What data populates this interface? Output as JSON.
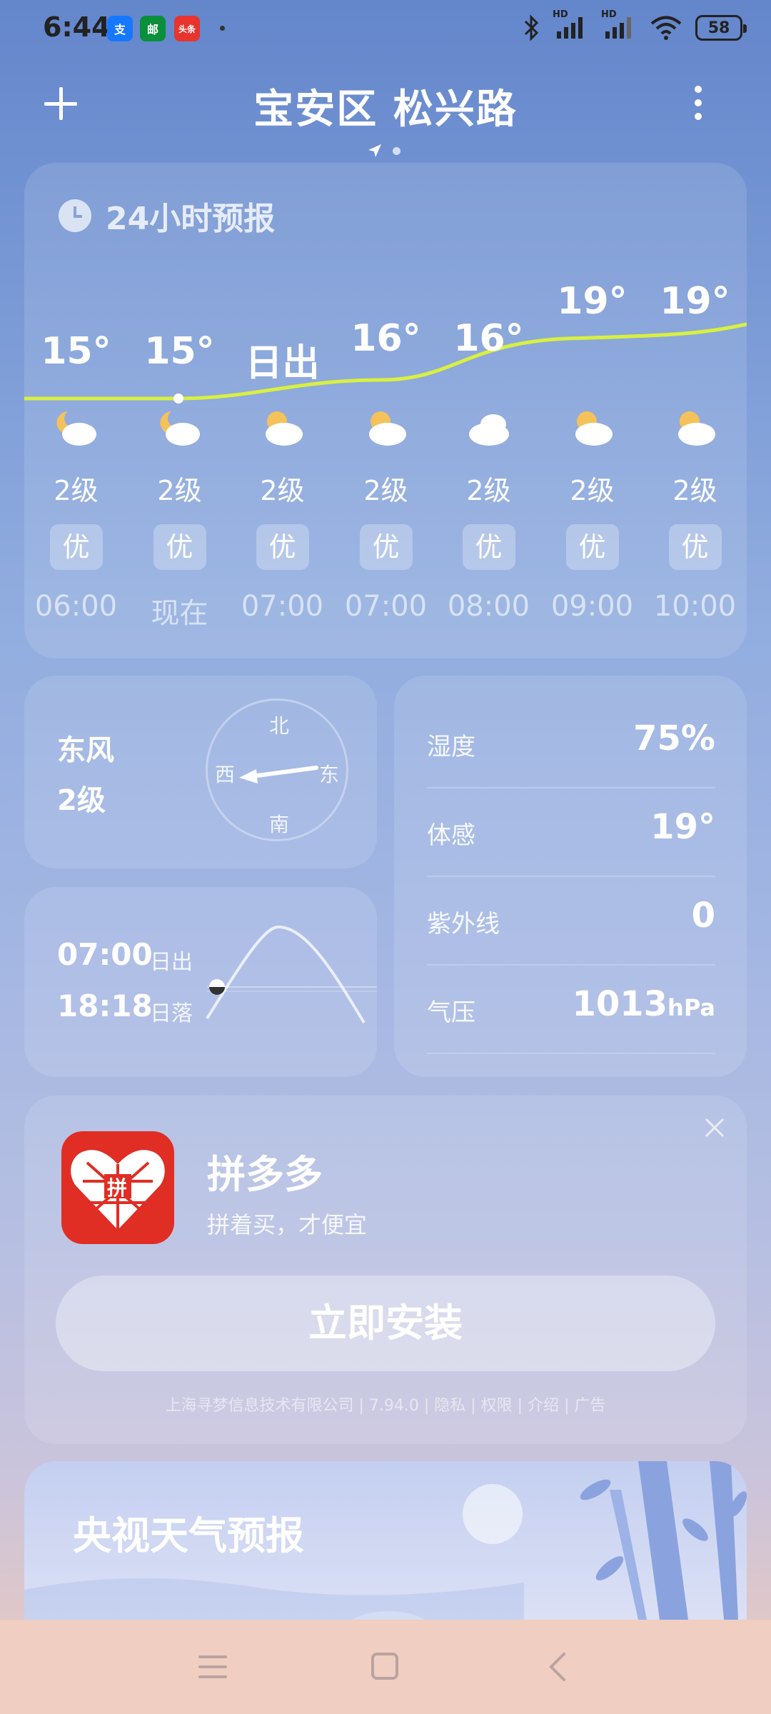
{
  "status_bar": {
    "time": "6:44",
    "app_icons": [
      {
        "name": "alipay-icon",
        "label": "支",
        "color": "#1677ff"
      },
      {
        "name": "post-icon",
        "label": "邮",
        "color": "#0a8f3a"
      },
      {
        "name": "toutiao-icon",
        "label": "头条",
        "color": "#e8342c"
      }
    ],
    "network_left": "HD",
    "network_right": "HD",
    "battery": "58"
  },
  "header": {
    "location": "宝安区 松兴路"
  },
  "forecast": {
    "title": "24小时预报",
    "items": [
      {
        "temp": "15°",
        "wind": "2级",
        "aqi": "优",
        "hour": "06:00",
        "icon": "moon-cloud-icon"
      },
      {
        "temp": "15°",
        "wind": "2级",
        "aqi": "优",
        "hour": "现在",
        "icon": "moon-cloud-icon"
      },
      {
        "temp": "日出",
        "wind": "2级",
        "aqi": "优",
        "hour": "07:00",
        "icon": "sun-cloud-icon"
      },
      {
        "temp": "16°",
        "wind": "2级",
        "aqi": "优",
        "hour": "07:00",
        "icon": "sun-cloud-icon"
      },
      {
        "temp": "16°",
        "wind": "2级",
        "aqi": "优",
        "hour": "08:00",
        "icon": "cloud-icon"
      },
      {
        "temp": "19°",
        "wind": "2级",
        "aqi": "优",
        "hour": "09:00",
        "icon": "sun-cloud-icon"
      },
      {
        "temp": "19°",
        "wind": "2级",
        "aqi": "优",
        "hour": "10:00",
        "icon": "sun-cloud-icon"
      }
    ]
  },
  "wind": {
    "direction": "东风",
    "level": "2级",
    "compass": {
      "north": "北",
      "south": "南",
      "east": "东",
      "west": "西"
    }
  },
  "sun": {
    "sunrise_time": "07:00",
    "sunrise_label": "日出",
    "sunset_time": "18:18",
    "sunset_label": "日落"
  },
  "details": [
    {
      "label": "湿度",
      "value": "75%",
      "unit": ""
    },
    {
      "label": "体感",
      "value": "19°",
      "unit": ""
    },
    {
      "label": "紫外线",
      "value": "0",
      "unit": ""
    },
    {
      "label": "气压",
      "value": "1013",
      "unit": "hPa"
    }
  ],
  "ad": {
    "app_name": "拼多多",
    "slogan": "拼着买，才便宜",
    "logo_text": "拼",
    "install_label": "立即安装",
    "footer": "上海寻梦信息技术有限公司 | 7.94.0 | 隐私 | 权限 | 介绍 | 广告"
  },
  "cctv": {
    "title": "央视天气预报"
  },
  "colors": {
    "temp_curve": "#d8f040",
    "pdd_red": "#e02e24"
  }
}
